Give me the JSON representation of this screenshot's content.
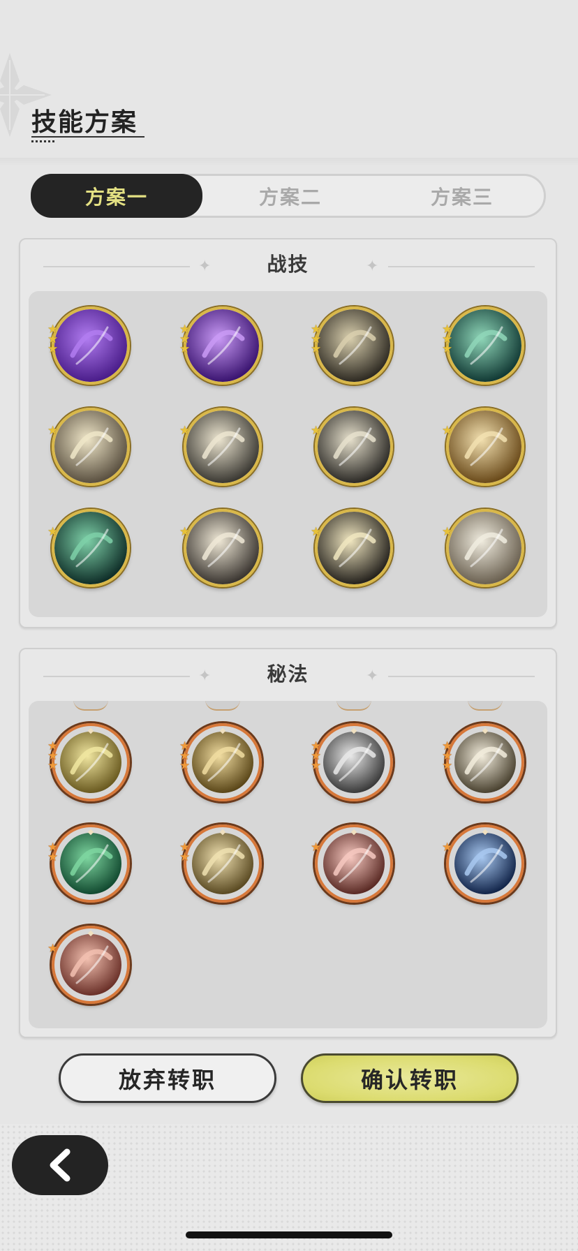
{
  "header": {
    "title": "技能方案"
  },
  "tabs": [
    {
      "label": "方案一",
      "active": true
    },
    {
      "label": "方案二",
      "active": false
    },
    {
      "label": "方案三",
      "active": false
    }
  ],
  "combat_panel": {
    "title": "战技",
    "skills": [
      {
        "icon": "purple-heart-icon",
        "stars": 3,
        "colors": [
          "#b17cf0",
          "#4a1d8a"
        ]
      },
      {
        "icon": "purple-comet-icon",
        "stars": 3,
        "colors": [
          "#c99af5",
          "#3a1470"
        ]
      },
      {
        "icon": "golden-sword-slash-icon",
        "stars": 3,
        "colors": [
          "#d9cfae",
          "#2e2a22"
        ]
      },
      {
        "icon": "green-web-icon",
        "stars": 3,
        "colors": [
          "#8fd6b8",
          "#123a35"
        ]
      },
      {
        "icon": "light-shield-strike-icon",
        "stars": 1,
        "colors": [
          "#efe6c8",
          "#5a5040"
        ]
      },
      {
        "icon": "wind-slash-icon",
        "stars": 1,
        "colors": [
          "#ece5d0",
          "#3a3832"
        ]
      },
      {
        "icon": "whirlwind-icon",
        "stars": 1,
        "colors": [
          "#e6e0cc",
          "#2c2a26"
        ]
      },
      {
        "icon": "golden-vortex-icon",
        "stars": 1,
        "colors": [
          "#f2e0b0",
          "#6a4a1a"
        ]
      },
      {
        "icon": "green-crescent-icon",
        "stars": 1,
        "colors": [
          "#7ed0a8",
          "#0f2e28"
        ]
      },
      {
        "icon": "light-burst-icon",
        "stars": 1,
        "colors": [
          "#efe8d6",
          "#3a3530"
        ]
      },
      {
        "icon": "lightning-slash-icon",
        "stars": 1,
        "colors": [
          "#f0e6c0",
          "#25221d"
        ]
      },
      {
        "icon": "beast-charge-icon",
        "stars": 1,
        "colors": [
          "#f0ecdf",
          "#6a6050"
        ]
      }
    ]
  },
  "arcane_panel": {
    "title": "秘法",
    "skills": [
      {
        "icon": "radiant-figure-icon",
        "stars": 3,
        "colors": [
          "#f0e6a0",
          "#6a5a20"
        ]
      },
      {
        "icon": "golden-swirl-icon",
        "stars": 3,
        "colors": [
          "#f0dca0",
          "#5a4618"
        ]
      },
      {
        "icon": "shield-guardian-icon",
        "stars": 3,
        "colors": [
          "#e8e8e8",
          "#3a3a3a"
        ]
      },
      {
        "icon": "leaf-crescent-icon",
        "stars": 3,
        "colors": [
          "#f2ecdc",
          "#4a4230"
        ]
      },
      {
        "icon": "green-leaf-icon",
        "stars": 2,
        "colors": [
          "#7ed6a0",
          "#124a30"
        ]
      },
      {
        "icon": "golden-guardian-icon",
        "stars": 2,
        "colors": [
          "#efe0b0",
          "#5a4a22"
        ]
      },
      {
        "icon": "pink-slash-icon",
        "stars": 1,
        "colors": [
          "#f6c8c0",
          "#5a2a24"
        ]
      },
      {
        "icon": "blue-crystal-icon",
        "stars": 1,
        "colors": [
          "#a8c8f0",
          "#12254a"
        ]
      },
      {
        "icon": "pink-flower-icon",
        "stars": 1,
        "colors": [
          "#f2c0b0",
          "#6a3028"
        ]
      }
    ]
  },
  "actions": {
    "abandon_label": "放弃转职",
    "confirm_label": "确认转职"
  },
  "nav": {
    "back_icon": "chevron-left-icon"
  },
  "colors": {
    "tab_active_bg": "#242424",
    "tab_active_text": "#e4e183",
    "confirm_button": "#dcdc70",
    "gold_ring": "#d9b84a",
    "orange_ring": "#d7783a"
  }
}
